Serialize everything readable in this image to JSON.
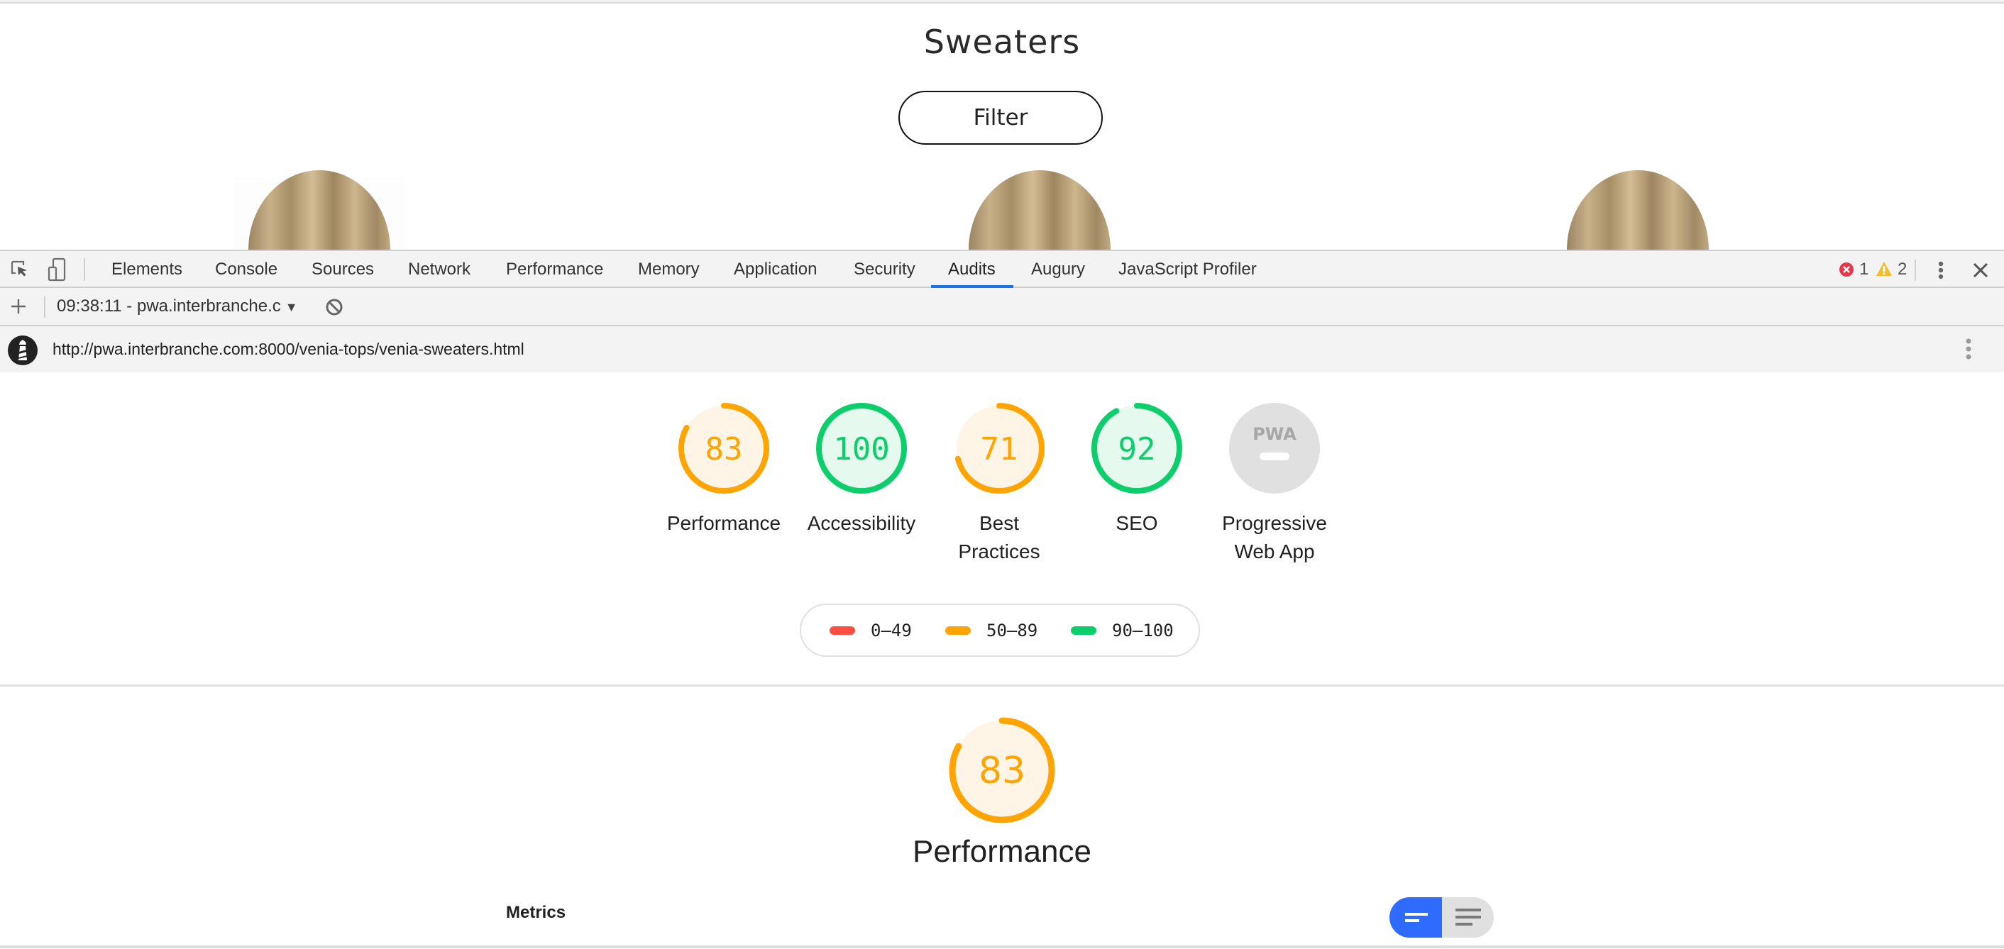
{
  "page": {
    "title": "Sweaters",
    "filter_label": "Filter",
    "products": [
      {
        "name": "product-image-1"
      },
      {
        "name": "product-image-2"
      },
      {
        "name": "product-image-3"
      }
    ]
  },
  "devtools": {
    "tabs": [
      {
        "label": "Elements"
      },
      {
        "label": "Console"
      },
      {
        "label": "Sources"
      },
      {
        "label": "Network"
      },
      {
        "label": "Performance"
      },
      {
        "label": "Memory"
      },
      {
        "label": "Application"
      },
      {
        "label": "Security"
      },
      {
        "label": "Audits",
        "active": true
      },
      {
        "label": "Augury"
      },
      {
        "label": "JavaScript Profiler"
      }
    ],
    "error_count": "1",
    "warning_count": "2",
    "report_select": "09:38:11 - pwa.interbranche.c",
    "url": "http://pwa.interbranche.com:8000/venia-tops/venia-sweaters.html"
  },
  "report": {
    "colors": {
      "fail": "#ff4e42",
      "average": "#ffa400",
      "pass": "#0cce6b",
      "average_bg": "#fff5e6",
      "pass_bg": "#e6f9ee",
      "na_bg": "#e0e0e0",
      "toggle_active": "#2f6bff"
    },
    "categories": [
      {
        "id": "performance",
        "label_line1": "Performance",
        "label_line2": "",
        "score": 83,
        "rating": "average"
      },
      {
        "id": "accessibility",
        "label_line1": "Accessibility",
        "label_line2": "",
        "score": 100,
        "rating": "pass"
      },
      {
        "id": "best-practices",
        "label_line1": "Best",
        "label_line2": "Practices",
        "score": 71,
        "rating": "average"
      },
      {
        "id": "seo",
        "label_line1": "SEO",
        "label_line2": "",
        "score": 92,
        "rating": "pass"
      },
      {
        "id": "pwa",
        "label_line1": "Progressive",
        "label_line2": "Web App",
        "score": null,
        "rating": "na",
        "badge_text": "PWA"
      }
    ],
    "legend": [
      {
        "range": "0–49",
        "rating": "fail"
      },
      {
        "range": "50–89",
        "rating": "average"
      },
      {
        "range": "90–100",
        "rating": "pass"
      }
    ],
    "performance_section": {
      "score": 83,
      "score_text": "83",
      "heading": "Performance",
      "metrics_label": "Metrics"
    }
  }
}
